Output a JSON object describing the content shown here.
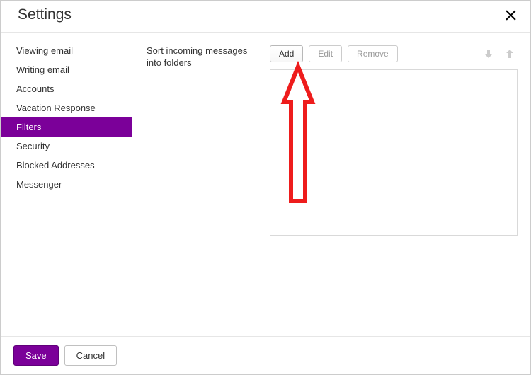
{
  "header": {
    "title": "Settings"
  },
  "sidebar": {
    "items": [
      {
        "label": "Viewing email",
        "active": false
      },
      {
        "label": "Writing email",
        "active": false
      },
      {
        "label": "Accounts",
        "active": false
      },
      {
        "label": "Vacation Response",
        "active": false
      },
      {
        "label": "Filters",
        "active": true
      },
      {
        "label": "Security",
        "active": false
      },
      {
        "label": "Blocked Addresses",
        "active": false
      },
      {
        "label": "Messenger",
        "active": false
      }
    ]
  },
  "content": {
    "description": "Sort incoming messages into folders",
    "buttons": {
      "add": "Add",
      "edit": "Edit",
      "remove": "Remove"
    }
  },
  "footer": {
    "save": "Save",
    "cancel": "Cancel"
  }
}
